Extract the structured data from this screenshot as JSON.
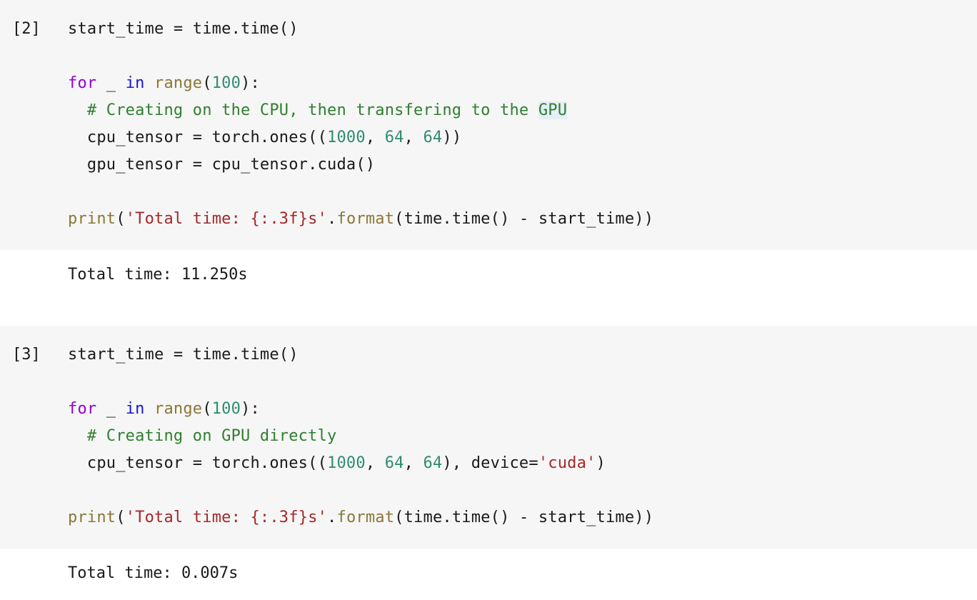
{
  "theme": {
    "page_background": "#ffffff",
    "code_cell_background": "#f6f6f6",
    "output_background": "#ffffff",
    "default_text": "#1a1a1a",
    "keyword_color": "#9400d3",
    "operator_keyword_color": "#1515d6",
    "builtin_color": "#8a7738",
    "number_color": "#2e8b72",
    "string_color": "#a52828",
    "comment_color": "#2f7f2f",
    "selection_highlight": "#e6eef7"
  },
  "cells": [
    {
      "prompt": "[2]",
      "lines": {
        "l1_code": "start_time = time.time()",
        "l2_blank": " ",
        "l3_kw_for": "for",
        "l3_underscore": " _ ",
        "l3_kw_in": "in",
        "l3_space": " ",
        "l3_builtin_range": "range",
        "l3_paren_open": "(",
        "l3_num_100": "100",
        "l3_paren_close": "):",
        "l4_comment_pre": "  # Creating on the CPU, then transfering to the ",
        "l4_comment_highlight": "GPU",
        "l5_pre": "  cpu_tensor = torch.ones((",
        "l5_num_1000": "1000",
        "l5_sep1": ", ",
        "l5_num_64a": "64",
        "l5_sep2": ", ",
        "l5_num_64b": "64",
        "l5_post": "))",
        "l6_code": "  gpu_tensor = cpu_tensor.cuda()",
        "l7_blank": " ",
        "l8_builtin_print": "print",
        "l8_paren_open": "(",
        "l8_string": "'Total time: {:.3f}s'",
        "l8_dot": ".",
        "l8_builtin_format": "format",
        "l8_tail": "(time.time() - start_time))"
      },
      "output": "Total time: 11.250s"
    },
    {
      "prompt": "[3]",
      "lines": {
        "l1_code": "start_time = time.time()",
        "l2_blank": " ",
        "l3_kw_for": "for",
        "l3_underscore": " _ ",
        "l3_kw_in": "in",
        "l3_space": " ",
        "l3_builtin_range": "range",
        "l3_paren_open": "(",
        "l3_num_100": "100",
        "l3_paren_close": "):",
        "l4_comment": "  # Creating on GPU directly",
        "l5_pre": "  cpu_tensor = torch.ones((",
        "l5_num_1000": "1000",
        "l5_sep1": ", ",
        "l5_num_64a": "64",
        "l5_sep2": ", ",
        "l5_num_64b": "64",
        "l5_mid": "), device=",
        "l5_string": "'cuda'",
        "l5_post": ")",
        "l7_blank": " ",
        "l8_builtin_print": "print",
        "l8_paren_open": "(",
        "l8_string": "'Total time: {:.3f}s'",
        "l8_dot": ".",
        "l8_builtin_format": "format",
        "l8_tail": "(time.time() - start_time))"
      },
      "output": "Total time: 0.007s"
    }
  ]
}
